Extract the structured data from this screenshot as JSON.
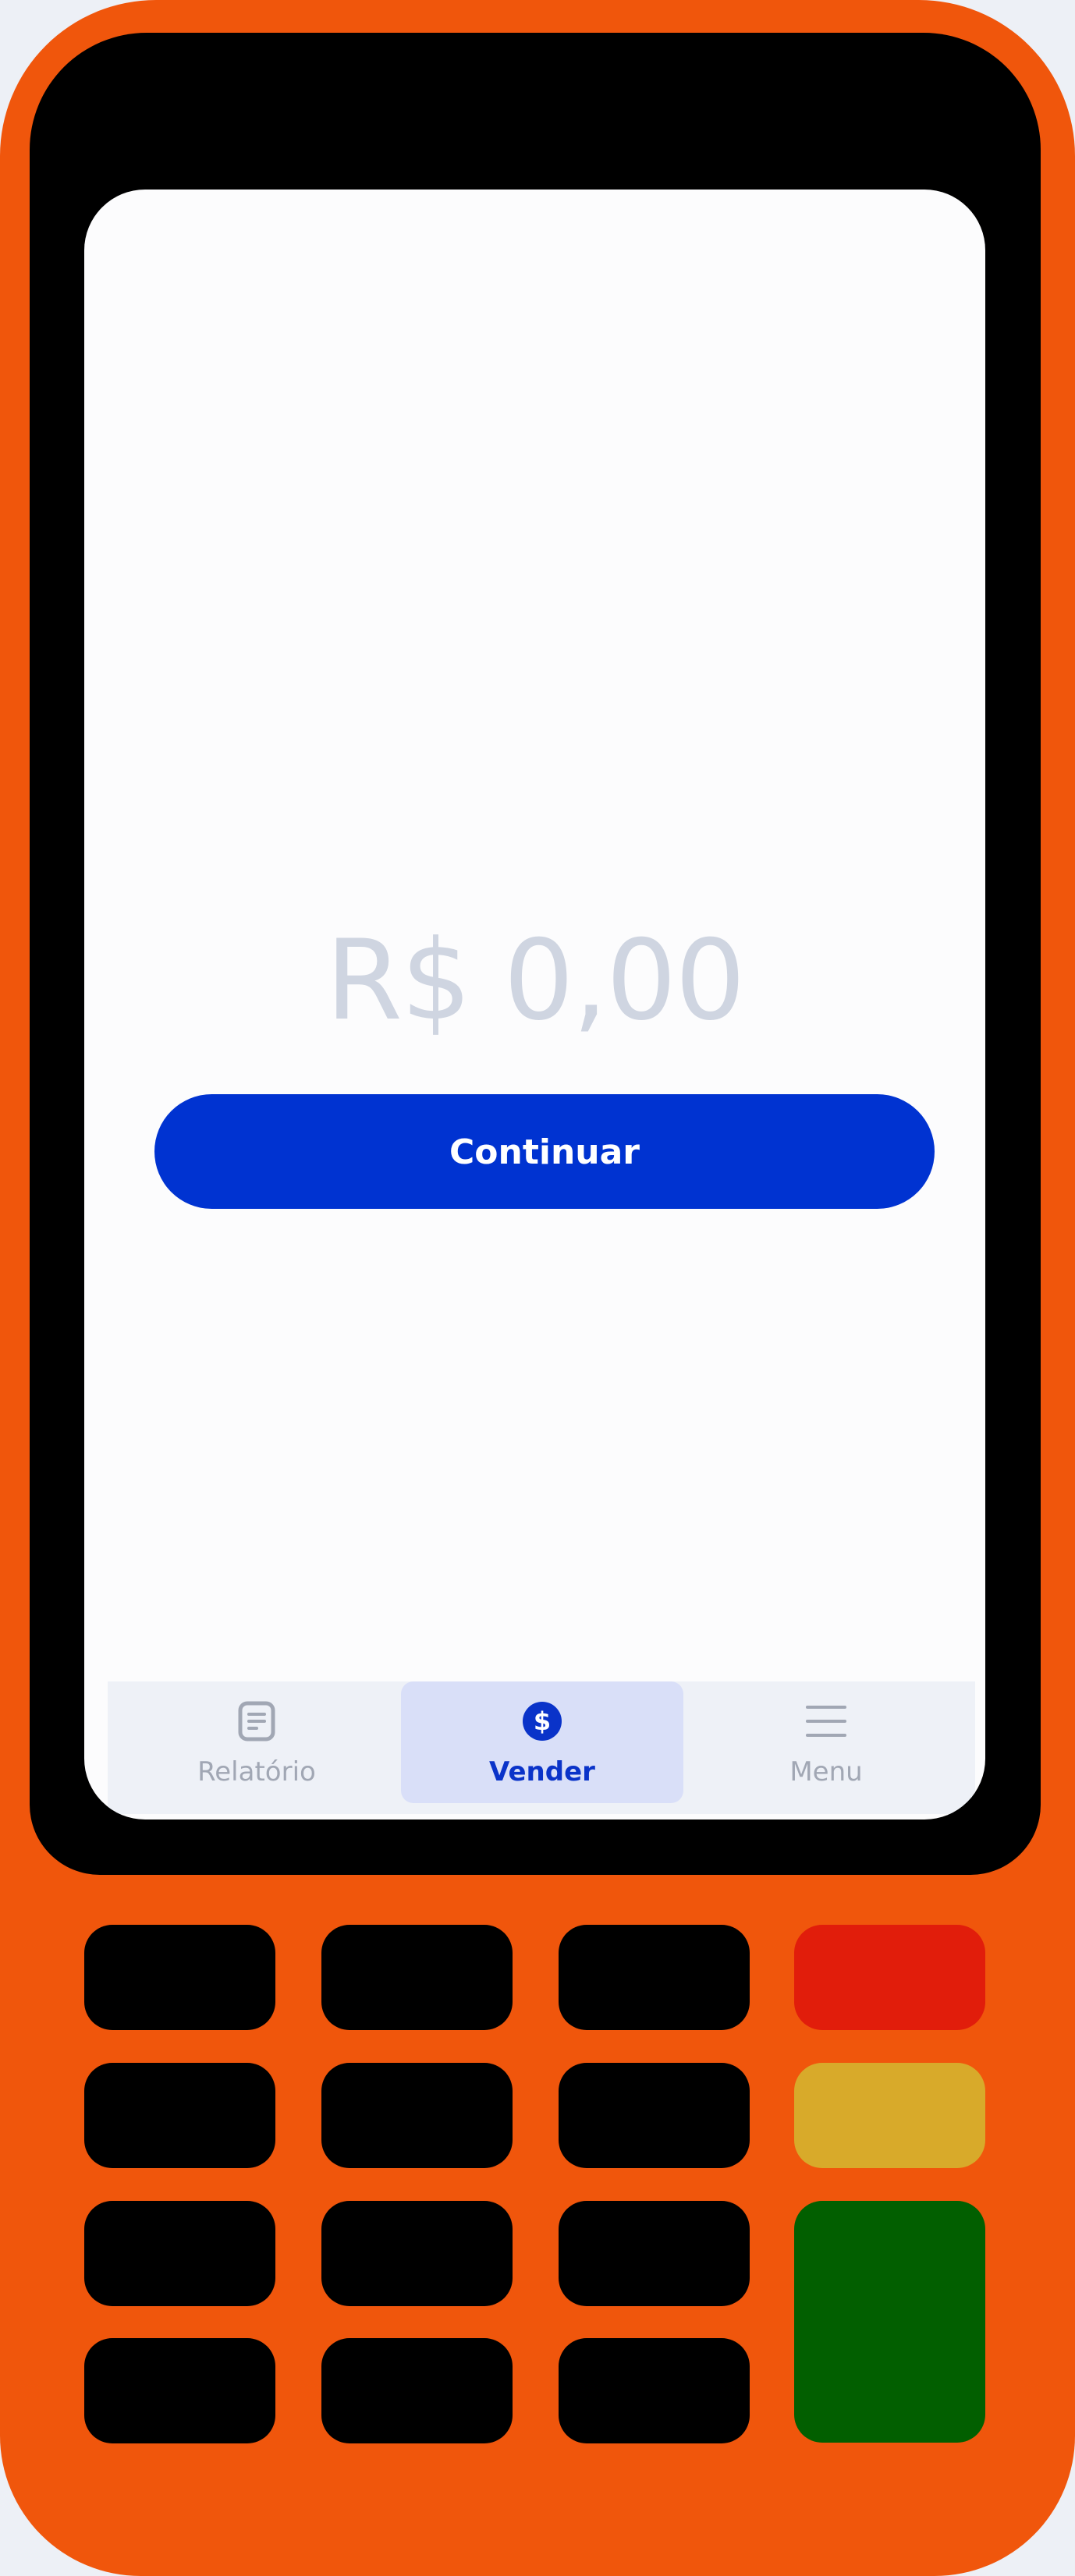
{
  "amount_display": "R$ 0,00",
  "continue_label": "Continuar",
  "tabs": [
    {
      "label": "Relatório",
      "icon": "report-icon",
      "selected": false
    },
    {
      "label": "Vender",
      "icon": "dollar-coin-icon",
      "selected": true
    },
    {
      "label": "Menu",
      "icon": "hamburger-menu-icon",
      "selected": false
    }
  ],
  "colors": {
    "device_body": "#f0560c",
    "bezel": "#000000",
    "primary": "#0033d1",
    "amount_text": "#cfd5e1",
    "key_cancel": "#e11d0b",
    "key_clear": "#d8aa2a",
    "key_confirm": "#025f00"
  }
}
